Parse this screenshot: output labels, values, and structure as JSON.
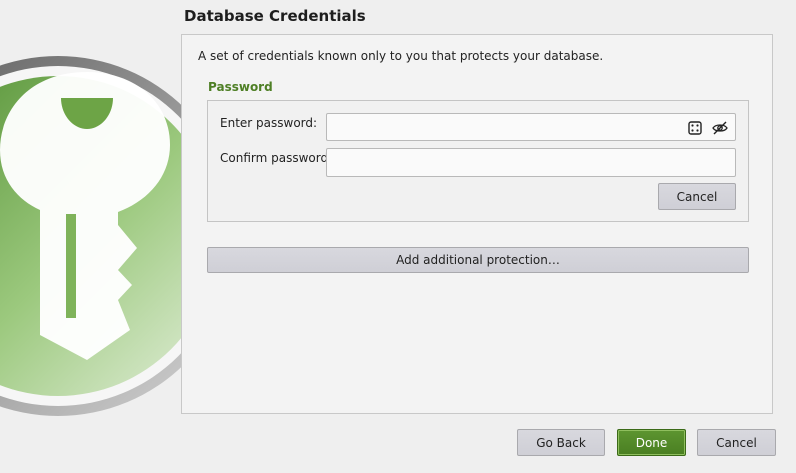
{
  "header": {
    "title": "Database Credentials"
  },
  "main": {
    "description": "A set of credentials known only to you that protects your database.",
    "password_section": {
      "title": "Password",
      "enter_label": "Enter password:",
      "enter_value": "",
      "confirm_label": "Confirm password:",
      "confirm_value": "",
      "icons": [
        "dice-icon",
        "eye-slash-icon"
      ],
      "cancel_label": "Cancel"
    },
    "additional_protection_label": "Add additional protection…"
  },
  "footer": {
    "go_back_label": "Go Back",
    "done_label": "Done",
    "cancel_label": "Cancel"
  },
  "colors": {
    "accent": "#4e7f25",
    "primary_button": "#55892b",
    "button": "#d4d4da"
  }
}
